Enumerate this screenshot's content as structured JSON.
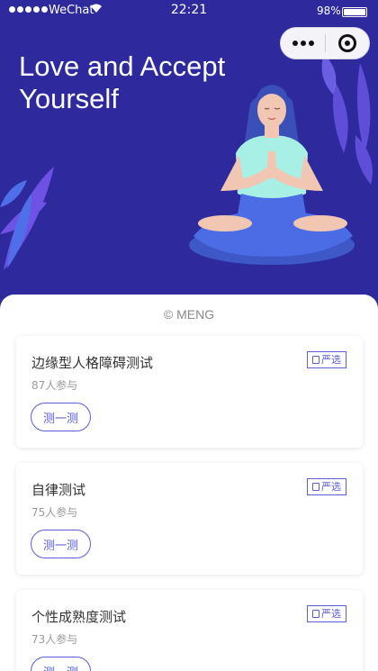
{
  "status_bar": {
    "carrier": "WeChat",
    "time": "22:21",
    "battery": "98%",
    "battery_level": 0.98
  },
  "hero": {
    "title": "Love and Accept Yourself"
  },
  "copyright": "© MENG",
  "tests": [
    {
      "title": "边缘型人格障碍测试",
      "participants": "87人参与",
      "tag": "严选",
      "button": "测一测"
    },
    {
      "title": "自律测试",
      "participants": "75人参与",
      "tag": "严选",
      "button": "测一测"
    },
    {
      "title": "个性成熟度测试",
      "participants": "73人参与",
      "tag": "严选",
      "button": "测一测"
    }
  ],
  "colors": {
    "hero_bg": "#2e2a9e",
    "accent": "#5a5fd6"
  },
  "icons": {
    "more": "more-dots-icon",
    "close": "target-close-icon",
    "wifi": "wifi-icon",
    "tag": "edit-icon"
  }
}
